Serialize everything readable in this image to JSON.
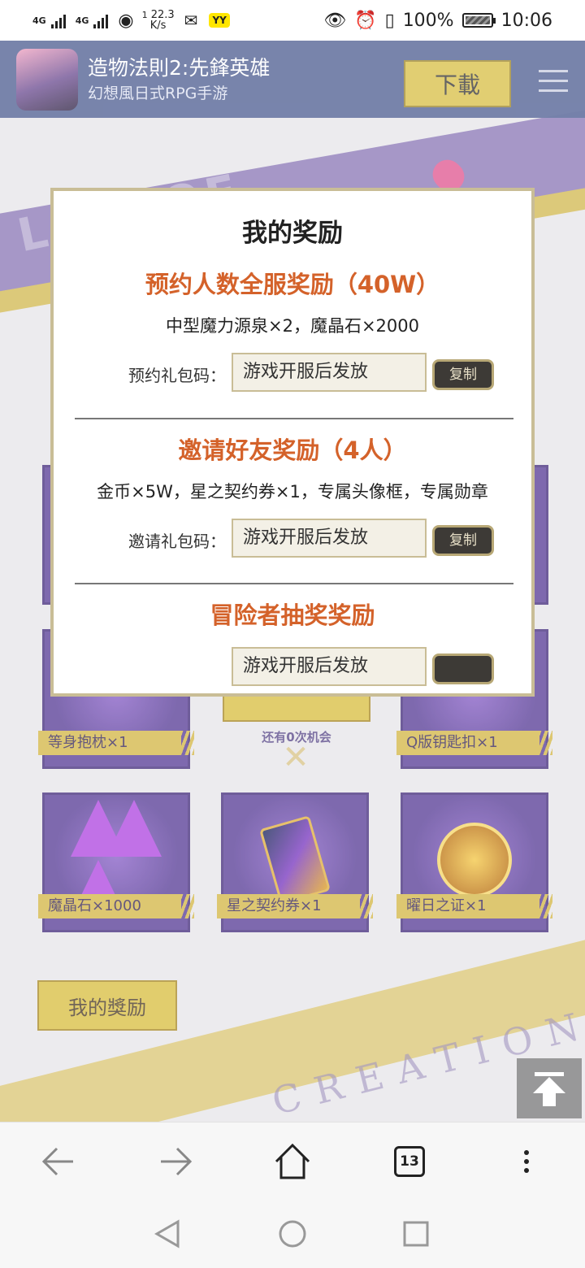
{
  "status_bar": {
    "network1": "4G",
    "network2": "4G",
    "speed_value": "22.3",
    "speed_unit": "K/s",
    "speed_prefix": "1",
    "yy_badge": "YY",
    "battery": "100%",
    "time": "10:06"
  },
  "header": {
    "app_name": "造物法則2:先鋒英雄",
    "app_subtitle": "幻想風日式RPG手游",
    "download_label": "下載"
  },
  "background": {
    "logo_text": "LAW OF",
    "bottom_text": "CREATION"
  },
  "prizes": {
    "row1_left": "等身抱枕×1",
    "row1_right": "Q版钥匙扣×1",
    "row2": [
      {
        "label": "魔晶石×1000"
      },
      {
        "label": "星之契约券×1"
      },
      {
        "label": "曜日之证×1"
      }
    ],
    "chances_text": "还有0次机会"
  },
  "my_rewards_button": "我的獎励",
  "modal": {
    "title": "我的奖励",
    "sections": [
      {
        "title": "预约人数全服奖励（40W）",
        "description": "中型魔力源泉×2，魔晶石×2000",
        "code_label": "预约礼包码：",
        "code_value": "游戏开服后发放",
        "copy_label": "复制"
      },
      {
        "title": "邀请好友奖励（4人）",
        "description": "金币×5W，星之契约券×1，专属头像框，专属勋章",
        "code_label": "邀请礼包码：",
        "code_value": "游戏开服后发放",
        "copy_label": "复制"
      },
      {
        "title": "冒险者抽奖奖励",
        "code_value": "游戏开服后发放"
      }
    ]
  },
  "browser": {
    "tab_count": "13"
  },
  "colors": {
    "accent_orange": "#d4622a",
    "gold": "#d9bf45",
    "purple": "#5a3f98",
    "header_blue": "#4c5d91"
  }
}
